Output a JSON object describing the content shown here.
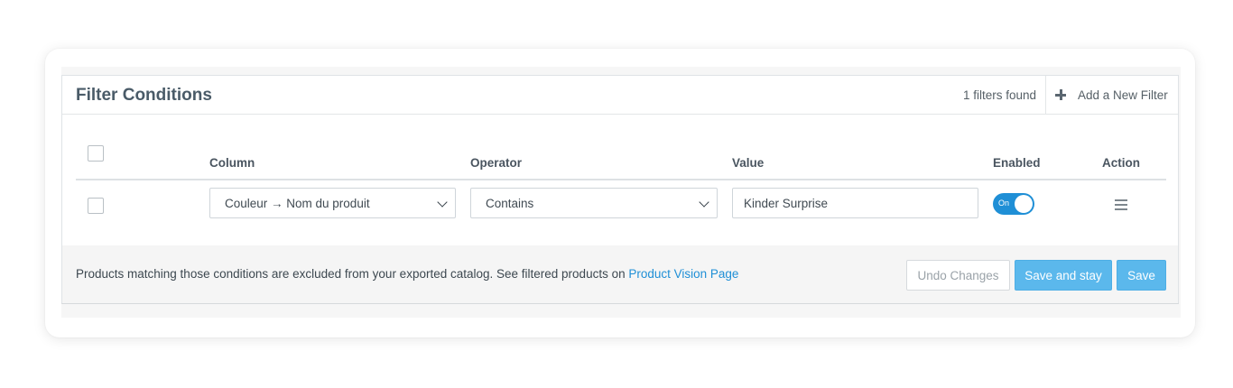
{
  "header": {
    "title": "Filter Conditions",
    "filters_found": "1 filters found",
    "add_filter_label": "Add a New Filter"
  },
  "table": {
    "columns": {
      "column": "Column",
      "operator": "Operator",
      "value": "Value",
      "enabled": "Enabled",
      "action": "Action"
    },
    "rows": [
      {
        "column_value": "Couleur → Nom du produit",
        "operator_value": "Contains",
        "value": "Kinder Surprise",
        "enabled_label": "On"
      }
    ]
  },
  "footer": {
    "text": "Products matching those conditions are excluded from your exported catalog. See filtered products on",
    "link": "Product Vision Page",
    "undo_label": "Undo Changes",
    "save_stay_label": "Save and stay",
    "save_label": "Save"
  },
  "colors": {
    "accent": "#1f8fd6",
    "button": "#5bb8ec"
  },
  "icons": {
    "add": "plus-icon",
    "dropdown": "chevron-down-icon",
    "row_menu": "menu-icon"
  }
}
